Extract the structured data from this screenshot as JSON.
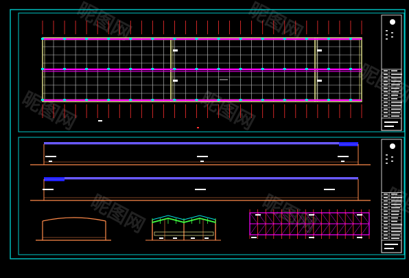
{
  "viewer": {
    "background": "#000000",
    "frame_color": "#00c8c8",
    "watermark_text": "昵图网",
    "watermark_color": "#ffffff"
  },
  "drawing": {
    "colors": {
      "grid": "#c8c8c8",
      "outline": "#e8e890",
      "beam": "#ff00ff",
      "roof": "#6a5aff",
      "ridge": "#2020ff",
      "dim": "#ff8a4a",
      "column": "#ff3030",
      "marker": "#00e6e6",
      "label": "#ffffff",
      "truss": "#40ff40"
    },
    "sheets": [
      {
        "name": "plan-sheet",
        "views": [
          "floor-plan"
        ]
      },
      {
        "name": "elevation-sheet",
        "views": [
          "long-elevation-1",
          "long-elevation-2",
          "gable-elevation",
          "cross-section",
          "roof-framing-plan"
        ]
      }
    ],
    "title_block": {
      "fields": 8,
      "signature_rows": 14
    }
  }
}
